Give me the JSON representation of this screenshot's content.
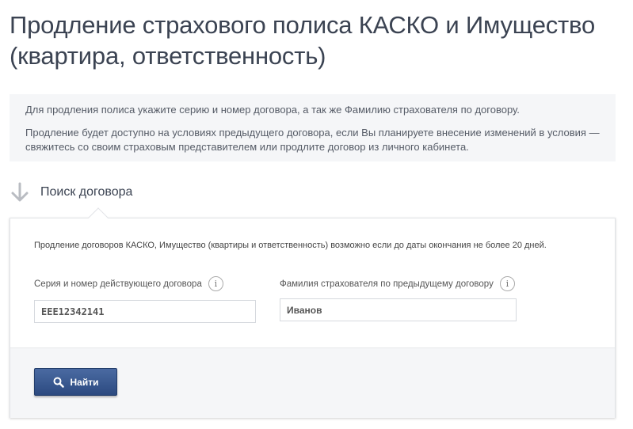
{
  "page": {
    "title": "Продление страхового полиса КАСКО и Имущество (квартира, ответственность)"
  },
  "info": {
    "paragraph1": "Для продления полиса укажите серию и номер договора, а так же Фамилию страхователя по договору.",
    "paragraph2": "Продление будет доступно на условиях предыдущего договора, если Вы планируете внесение изменений в условия — свяжитесь со своим страховым представителем или продлите договор из личного кабинета."
  },
  "section": {
    "title": "Поиск договора",
    "icon": "arrow-down-icon"
  },
  "form": {
    "notice": "Продление договоров КАСКО, Имущество (квартиры и ответственность) возможно если до даты окончания не более 20 дней.",
    "contract_label": "Серия и номер действующего договора",
    "contract_value": "ЕЕЕ12342141",
    "surname_label": "Фамилия страхователя по предыдущему договору",
    "surname_value": "Иванов",
    "info_icon_glyph": "i",
    "find_label": "Найти"
  },
  "colors": {
    "title": "#3b4352",
    "button": "#2c4a80",
    "panel_bg": "#f5f6f8"
  }
}
